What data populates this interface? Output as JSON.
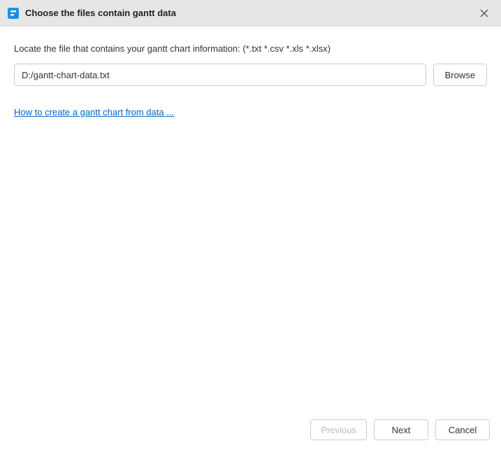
{
  "titlebar": {
    "title": "Choose the files contain gantt data"
  },
  "content": {
    "instruction": "Locate the file that contains your gantt chart information: (*.txt *.csv *.xls *.xlsx)",
    "filePath": "D:/gantt-chart-data.txt",
    "browseLabel": "Browse",
    "helpLink": "How to create a gantt chart from data ..."
  },
  "footer": {
    "previous": "Previous",
    "next": "Next",
    "cancel": "Cancel"
  }
}
